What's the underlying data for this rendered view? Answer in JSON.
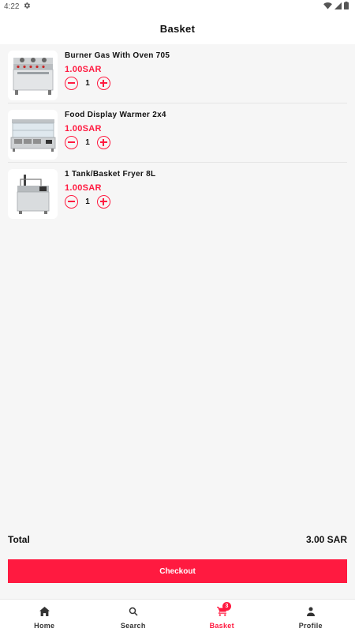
{
  "status_bar": {
    "time": "4:22"
  },
  "header": {
    "title": "Basket"
  },
  "items": [
    {
      "name": "Burner Gas With Oven 705",
      "price": "1.00SAR",
      "quantity": "1",
      "image_icon": "gas-oven-icon"
    },
    {
      "name": "Food Display Warmer 2x4",
      "price": "1.00SAR",
      "quantity": "1",
      "image_icon": "food-warmer-icon"
    },
    {
      "name": "1 Tank/Basket Fryer 8L",
      "price": "1.00SAR",
      "quantity": "1",
      "image_icon": "fryer-icon"
    }
  ],
  "summary": {
    "total_label": "Total",
    "total_value": "3.00 SAR"
  },
  "checkout_label": "Checkout",
  "nav": {
    "home": "Home",
    "search": "Search",
    "basket": "Basket",
    "basket_badge": "3",
    "profile": "Profile"
  },
  "colors": {
    "accent": "#ff1a40",
    "background": "#f6f6f6"
  }
}
